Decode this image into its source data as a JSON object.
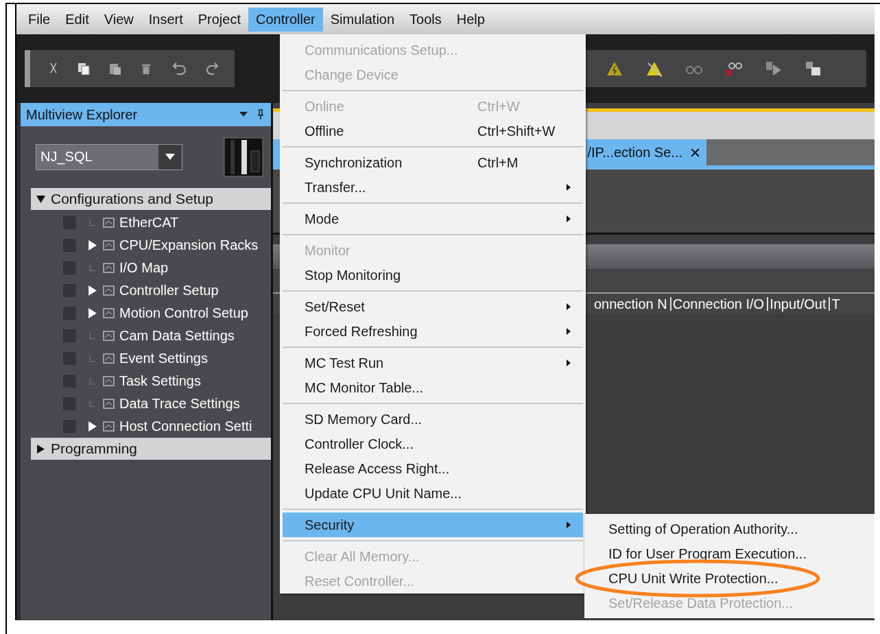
{
  "menubar": [
    {
      "label": "File",
      "selected": false
    },
    {
      "label": "Edit",
      "selected": false
    },
    {
      "label": "View",
      "selected": false
    },
    {
      "label": "Insert",
      "selected": false
    },
    {
      "label": "Project",
      "selected": false
    },
    {
      "label": "Controller",
      "selected": true
    },
    {
      "label": "Simulation",
      "selected": false
    },
    {
      "label": "Tools",
      "selected": false
    },
    {
      "label": "Help",
      "selected": false
    }
  ],
  "explorer": {
    "title": "Multiview Explorer",
    "device": "NJ_SQL",
    "sections": [
      {
        "label": "Configurations and Setup",
        "expanded": true,
        "children": [
          {
            "label": "EtherCAT",
            "expandable": false
          },
          {
            "label": "CPU/Expansion Racks",
            "expandable": true
          },
          {
            "label": "I/O Map",
            "expandable": false
          },
          {
            "label": "Controller Setup",
            "expandable": true
          },
          {
            "label": "Motion Control Setup",
            "expandable": true
          },
          {
            "label": "Cam Data Settings",
            "expandable": false
          },
          {
            "label": "Event Settings",
            "expandable": false
          },
          {
            "label": "Task Settings",
            "expandable": false
          },
          {
            "label": "Data Trace Settings",
            "expandable": false
          },
          {
            "label": "Host Connection Setti",
            "expandable": true
          }
        ]
      },
      {
        "label": "Programming",
        "expanded": false
      }
    ]
  },
  "editor": {
    "tab": {
      "label": "/IP...ection Se...",
      "selected": true
    },
    "columns": [
      "onnection N",
      "Connection I/O",
      "Input/Out",
      "T"
    ]
  },
  "controller_menu": {
    "items": [
      {
        "kind": "item",
        "label": "Communications Setup...",
        "disabled": true,
        "submenu": false,
        "selected": false
      },
      {
        "kind": "item",
        "label": "Change Device",
        "disabled": true,
        "submenu": false,
        "selected": false
      },
      {
        "kind": "separator"
      },
      {
        "kind": "item",
        "label": "Online",
        "shortcut": "Ctrl+W",
        "disabled": true,
        "submenu": false,
        "selected": false
      },
      {
        "kind": "item",
        "label": "Offline",
        "shortcut": "Ctrl+Shift+W",
        "disabled": false,
        "submenu": false,
        "selected": false
      },
      {
        "kind": "separator"
      },
      {
        "kind": "item",
        "label": "Synchronization",
        "shortcut": "Ctrl+M",
        "disabled": false,
        "submenu": false,
        "selected": false
      },
      {
        "kind": "item",
        "label": "Transfer...",
        "disabled": false,
        "submenu": true,
        "selected": false
      },
      {
        "kind": "separator"
      },
      {
        "kind": "item",
        "label": "Mode",
        "disabled": false,
        "submenu": true,
        "selected": false
      },
      {
        "kind": "separator"
      },
      {
        "kind": "item",
        "label": "Monitor",
        "disabled": true,
        "submenu": false,
        "selected": false
      },
      {
        "kind": "item",
        "label": "Stop Monitoring",
        "disabled": false,
        "submenu": false,
        "selected": false
      },
      {
        "kind": "separator"
      },
      {
        "kind": "item",
        "label": "Set/Reset",
        "disabled": false,
        "submenu": true,
        "selected": false
      },
      {
        "kind": "item",
        "label": "Forced Refreshing",
        "disabled": false,
        "submenu": true,
        "selected": false
      },
      {
        "kind": "separator"
      },
      {
        "kind": "item",
        "label": "MC Test Run",
        "disabled": false,
        "submenu": true,
        "selected": false
      },
      {
        "kind": "item",
        "label": "MC Monitor Table...",
        "disabled": false,
        "submenu": false,
        "selected": false
      },
      {
        "kind": "separator"
      },
      {
        "kind": "item",
        "label": "SD Memory Card...",
        "disabled": false,
        "submenu": false,
        "selected": false
      },
      {
        "kind": "item",
        "label": "Controller Clock...",
        "disabled": false,
        "submenu": false,
        "selected": false
      },
      {
        "kind": "item",
        "label": "Release Access Right...",
        "disabled": false,
        "submenu": false,
        "selected": false
      },
      {
        "kind": "item",
        "label": "Update CPU Unit Name...",
        "disabled": false,
        "submenu": false,
        "selected": false
      },
      {
        "kind": "separator"
      },
      {
        "kind": "item",
        "label": "Security",
        "disabled": false,
        "submenu": true,
        "selected": true
      },
      {
        "kind": "separator"
      },
      {
        "kind": "item",
        "label": "Clear All Memory...",
        "disabled": true,
        "submenu": false,
        "selected": false
      },
      {
        "kind": "item",
        "label": "Reset Controller...",
        "disabled": true,
        "submenu": false,
        "selected": false
      }
    ]
  },
  "security_submenu": {
    "items": [
      {
        "label": "Setting of Operation Authority...",
        "disabled": false,
        "circled": false
      },
      {
        "label": "ID for User Program Execution...",
        "disabled": false,
        "circled": false
      },
      {
        "label": "CPU Unit Write Protection...",
        "disabled": false,
        "circled": true
      },
      {
        "label": "Set/Release Data Protection...",
        "disabled": true,
        "circled": false
      }
    ]
  }
}
